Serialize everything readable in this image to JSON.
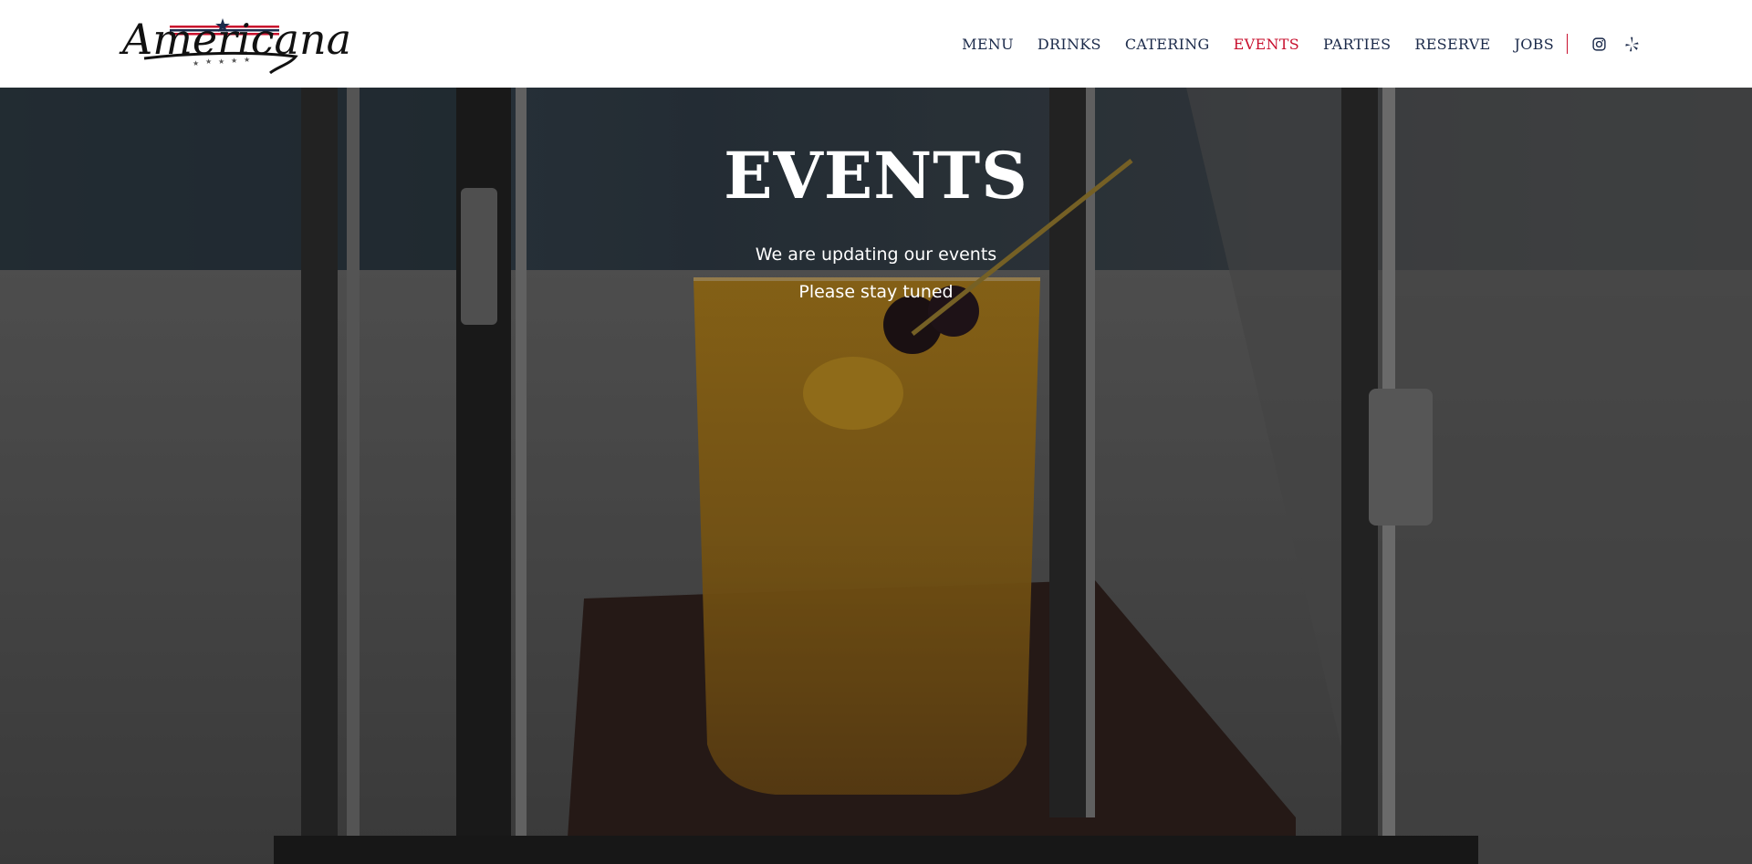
{
  "brand": {
    "logo_text": "Americana",
    "accent_red": "#c8102e",
    "navy": "#1b2a4a"
  },
  "nav": {
    "items": [
      {
        "label": "MENU",
        "active": false
      },
      {
        "label": "DRINKS",
        "active": false
      },
      {
        "label": "CATERING",
        "active": false
      },
      {
        "label": "EVENTS",
        "active": true
      },
      {
        "label": "PARTIES",
        "active": false
      },
      {
        "label": "RESERVE",
        "active": false
      },
      {
        "label": "JOBS",
        "active": false
      }
    ],
    "icons": [
      "instagram-icon",
      "yelp-icon"
    ]
  },
  "hero": {
    "title": "EVENTS",
    "line1": "We are updating our events",
    "line2": "Please stay tuned",
    "background": "cocktail-in-glass-display-case"
  }
}
